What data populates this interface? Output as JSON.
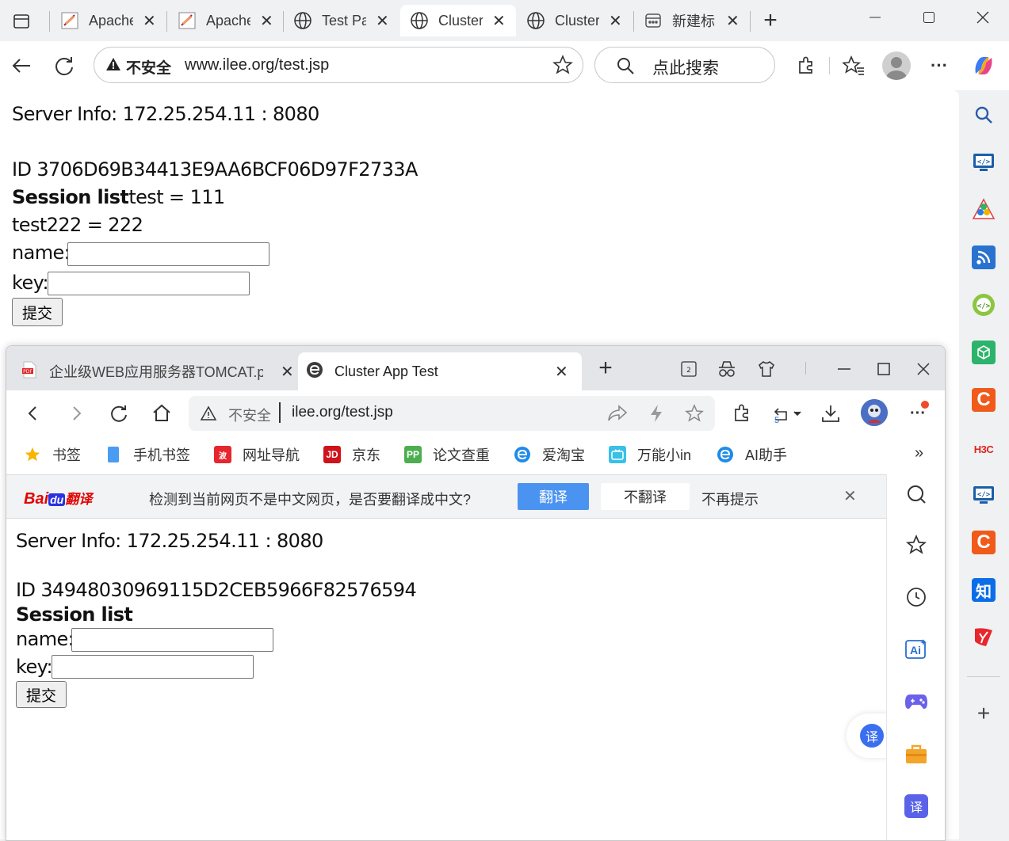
{
  "edge": {
    "tabs": [
      {
        "label": "Apache",
        "icon": "apache-feather-icon"
      },
      {
        "label": "Apache",
        "icon": "apache-feather-icon"
      },
      {
        "label": "Test Pa",
        "icon": "globe-icon"
      },
      {
        "label": "Cluster",
        "icon": "globe-icon"
      },
      {
        "label": "Cluster",
        "icon": "globe-icon"
      },
      {
        "label": "新建标",
        "icon": "new-tab-icon"
      }
    ],
    "address": {
      "warning": "不安全",
      "url": "www.ilee.org/test.jsp"
    },
    "search_placeholder": "点此搜索",
    "page": {
      "server_info": "Server Info: 172.25.254.11 : 8080",
      "session_id": "ID 3706D69B34413E9AA6BCF06D97F2733A",
      "session_list_label": "Session list",
      "session_item_1": "test = 111",
      "session_item_2": "test222 = 222",
      "name_label": "name:",
      "key_label": "key:",
      "submit_label": "提交"
    }
  },
  "browser360": {
    "tabs": [
      {
        "label": "企业级WEB应用服务器TOMCAT.p",
        "icon": "pdf-icon"
      },
      {
        "label": "Cluster App Test",
        "icon": "ie-e-icon"
      }
    ],
    "address": {
      "warning": "不安全",
      "url": "ilee.org/test.jsp"
    },
    "undo_count": "5",
    "bookmarks": [
      {
        "label": "书签",
        "icon": "star-icon"
      },
      {
        "label": "手机书签",
        "icon": "phone-icon"
      },
      {
        "label": "网址导航",
        "icon": "nav-icon"
      },
      {
        "label": "京东",
        "icon": "jd-icon"
      },
      {
        "label": "论文查重",
        "icon": "pp-icon"
      },
      {
        "label": "爱淘宝",
        "icon": "ie-e-icon"
      },
      {
        "label": "万能小in",
        "icon": "tv-icon"
      },
      {
        "label": "AI助手",
        "icon": "ie-e-icon"
      }
    ],
    "more_bookmarks": "»",
    "translate_bar": {
      "logo_text": "Bai",
      "logo_du": "du",
      "logo_suffix": "翻译",
      "message": "检测到当前网页不是中文网页，是否要翻译成中文?",
      "translate_button": "翻译",
      "no_translate_button": "不翻译",
      "never_show": "不再提示"
    },
    "page": {
      "server_info": "Server Info: 172.25.254.11 : 8080",
      "session_id": "ID 34948030969115D2CEB5966F82576594",
      "session_list_label": "Session list",
      "name_label": "name:",
      "key_label": "key:",
      "submit_label": "提交"
    },
    "float_translate": "译",
    "right_ai_label": "Ai",
    "right_translate_label": "译"
  },
  "sidebar": {
    "h3c_label": "H3C",
    "zhihu_label": "知",
    "c_label": "C"
  }
}
